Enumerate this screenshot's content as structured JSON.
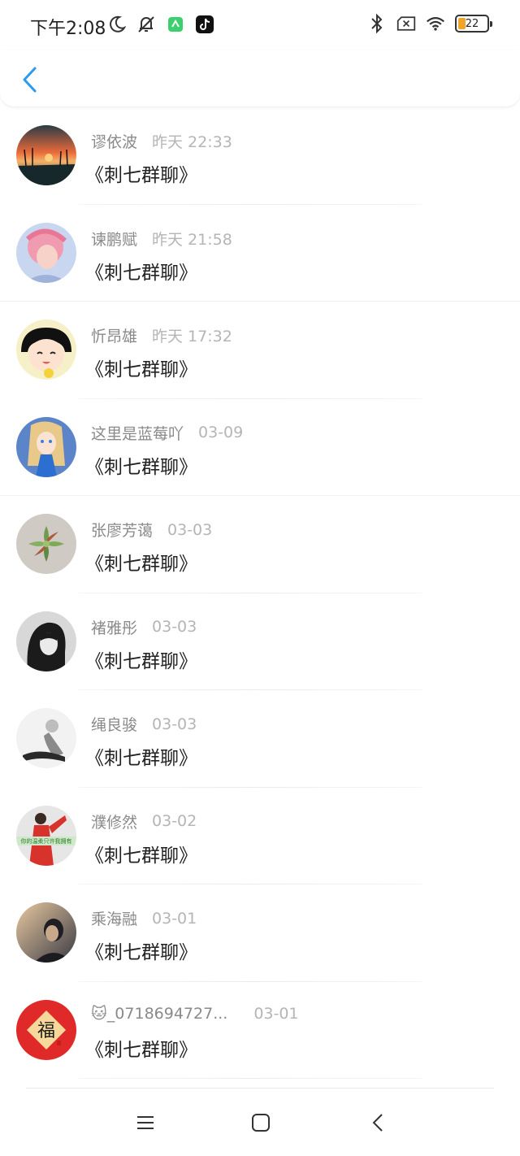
{
  "status_bar": {
    "time": "下午2:08",
    "battery_level": "22",
    "icons_left": [
      "moon-icon",
      "bell-off-icon",
      "green-app-icon",
      "tiktok-icon"
    ],
    "icons_right": [
      "bluetooth-icon",
      "no-sim-icon",
      "wifi-icon",
      "battery-icon"
    ]
  },
  "title_bar": {
    "back_icon": "chevron-left-icon"
  },
  "items": [
    {
      "name": "谬依波",
      "time": "昨天 22:33",
      "message": "《刺七群聊》"
    },
    {
      "name": "谏鹏赋",
      "time": "昨天 21:58",
      "message": "《刺七群聊》"
    },
    {
      "name": "忻昂雄",
      "time": "昨天 17:32",
      "message": "《刺七群聊》"
    },
    {
      "name": "这里是蓝莓吖",
      "time": "03-09",
      "message": "《刺七群聊》"
    },
    {
      "name": "张廖芳蔼",
      "time": "03-03",
      "message": "《刺七群聊》"
    },
    {
      "name": "褚雅彤",
      "time": "03-03",
      "message": "《刺七群聊》"
    },
    {
      "name": "绳良骏",
      "time": "03-03",
      "message": "《刺七群聊》"
    },
    {
      "name": "濮修然",
      "time": "03-02",
      "message": "《刺七群聊》",
      "avatar_caption": "你的温柔只许我拥有"
    },
    {
      "name": "乘海融",
      "time": "03-01",
      "message": "《刺七群聊》"
    },
    {
      "name": "🐱_0718694727...",
      "time": "03-01",
      "message": "《刺七群聊》",
      "avatar_caption": "福"
    }
  ],
  "nav_bar": {
    "icons": [
      "menu-icon",
      "home-square-icon",
      "back-triangle-icon"
    ]
  },
  "colors": {
    "accent": "#2a9bef",
    "name": "#8a8a8a",
    "time": "#b5b5b5",
    "battery": "#f0a52a"
  }
}
